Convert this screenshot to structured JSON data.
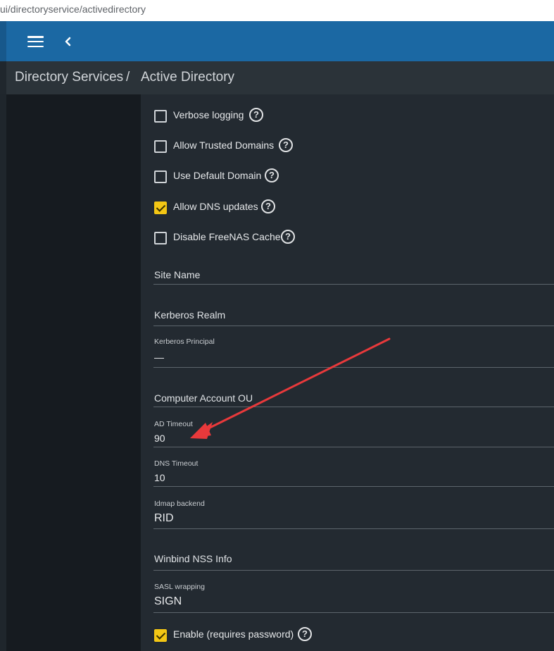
{
  "browser": {
    "url": "ui/directoryservice/activedirectory"
  },
  "breadcrumb": {
    "parent": "Directory Services",
    "separator": "/",
    "current": "Active Directory"
  },
  "checkboxes": {
    "verbose_logging": {
      "label": "Verbose logging",
      "checked": false
    },
    "allow_trusted_domains": {
      "label": "Allow Trusted Domains",
      "checked": false
    },
    "use_default_domain": {
      "label": "Use Default Domain",
      "checked": false
    },
    "allow_dns_updates": {
      "label": "Allow DNS updates",
      "checked": true
    },
    "disable_freenas_cache": {
      "label": "Disable FreeNAS Cache",
      "checked": false
    },
    "enable": {
      "label": "Enable (requires password)",
      "checked": true
    }
  },
  "fields": {
    "site_name": {
      "placeholder": "Site Name",
      "value": ""
    },
    "kerberos_realm": {
      "placeholder": "Kerberos Realm",
      "value": ""
    },
    "kerberos_principal": {
      "label": "Kerberos Principal",
      "value": "—"
    },
    "computer_account_ou": {
      "placeholder": "Computer Account OU",
      "value": ""
    },
    "ad_timeout": {
      "label": "AD Timeout",
      "value": "90"
    },
    "dns_timeout": {
      "label": "DNS Timeout",
      "value": "10"
    },
    "idmap_backend": {
      "label": "Idmap backend",
      "value": "RID"
    },
    "winbind_nss_info": {
      "placeholder": "Winbind NSS Info",
      "value": ""
    },
    "sasl_wrapping": {
      "label": "SASL wrapping",
      "value": "SIGN"
    }
  },
  "icons": {
    "menu": "hamburger-icon",
    "back": "chevron-left-icon",
    "help": "help-circle-icon"
  },
  "colors": {
    "topbar": "#1b68a3",
    "checkbox_checked": "#f3c614",
    "annotation_arrow": "#e8393b"
  },
  "help_glyph": "?"
}
